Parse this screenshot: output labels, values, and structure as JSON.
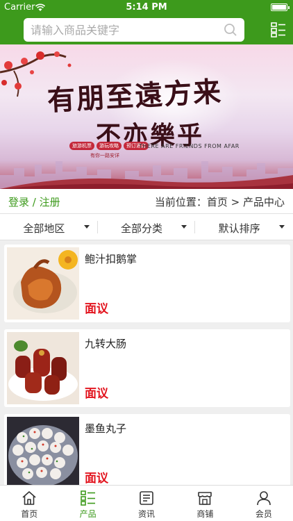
{
  "status_bar": {
    "carrier": "Carrier",
    "time": "5:14 PM"
  },
  "header": {
    "search_placeholder": "请输入商品关键字"
  },
  "banner": {
    "line1": "有朋至遠方来",
    "line2": "不亦樂乎",
    "tags": [
      "旅游机票",
      "游玩攻略",
      "预订酒店"
    ],
    "subtitle_cn": "有你一路安详",
    "subtitle_en": "THERE ARE FRIENDS FROM AFAR"
  },
  "breadcrumb": {
    "login": "登录 / 注册",
    "location": "当前位置：首页 > 产品中心"
  },
  "filters": [
    {
      "label": "全部地区"
    },
    {
      "label": "全部分类"
    },
    {
      "label": "默认排序"
    }
  ],
  "products": [
    {
      "name": "鲍汁扣鹅掌",
      "price": "面议"
    },
    {
      "name": "九转大肠",
      "price": "面议"
    },
    {
      "name": "墨鱼丸子",
      "price": "面议"
    }
  ],
  "tabbar": [
    {
      "label": "首页",
      "icon": "home-icon"
    },
    {
      "label": "产品",
      "icon": "list-icon",
      "active": true
    },
    {
      "label": "资讯",
      "icon": "news-icon"
    },
    {
      "label": "商铺",
      "icon": "shop-icon"
    },
    {
      "label": "会员",
      "icon": "user-icon"
    }
  ],
  "colors": {
    "brand_green": "#3d9a1c",
    "price_red": "#e2141e"
  }
}
